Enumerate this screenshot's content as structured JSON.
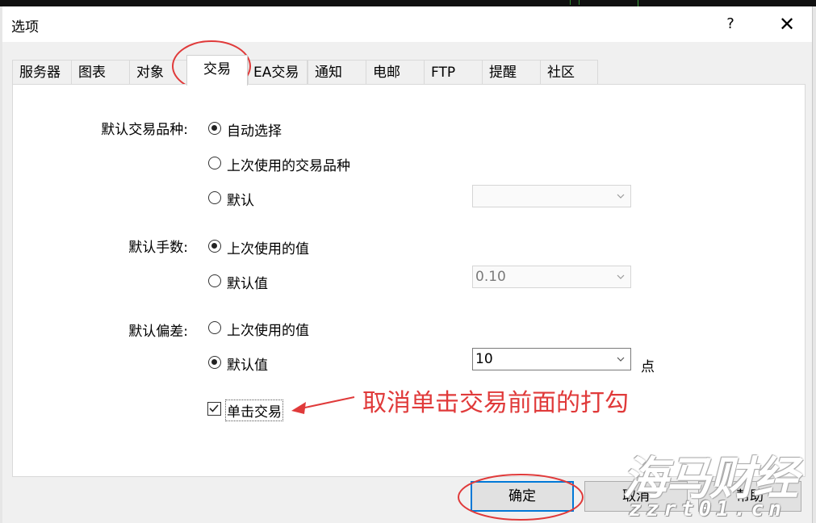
{
  "dialog": {
    "title": "选项",
    "help_symbol": "?",
    "close_symbol": "✕"
  },
  "tabs": [
    {
      "label": "服务器",
      "active": false
    },
    {
      "label": "图表",
      "active": false
    },
    {
      "label": "对象",
      "active": false
    },
    {
      "label": "交易",
      "active": true
    },
    {
      "label": "EA交易",
      "active": false
    },
    {
      "label": "通知",
      "active": false
    },
    {
      "label": "电邮",
      "active": false
    },
    {
      "label": "FTP",
      "active": false
    },
    {
      "label": "提醒",
      "active": false
    },
    {
      "label": "社区",
      "active": false
    }
  ],
  "trade": {
    "symbol": {
      "label": "默认交易品种:",
      "options": [
        "自动选择",
        "上次使用的交易品种",
        "默认"
      ],
      "selected": 0,
      "dropdown_value": ""
    },
    "lots": {
      "label": "默认手数:",
      "options": [
        "上次使用的值",
        "默认值"
      ],
      "selected": 0,
      "dropdown_value": "0.10"
    },
    "slippage": {
      "label": "默认偏差:",
      "options": [
        "上次使用的值",
        "默认值"
      ],
      "selected": 1,
      "dropdown_value": "10",
      "unit": "点"
    },
    "one_click": {
      "label": "单击交易",
      "checked": true
    }
  },
  "annotation": {
    "text": "取消单击交易前面的打勾",
    "color": "#e03a3a"
  },
  "buttons": {
    "ok": "确定",
    "cancel": "取消",
    "help": "帮助"
  },
  "watermark": {
    "line1": "海马财经",
    "line2": "zzrt01.cn"
  },
  "colors": {
    "annotation_red": "#e03a3a",
    "focus_blue": "#0078d7"
  }
}
